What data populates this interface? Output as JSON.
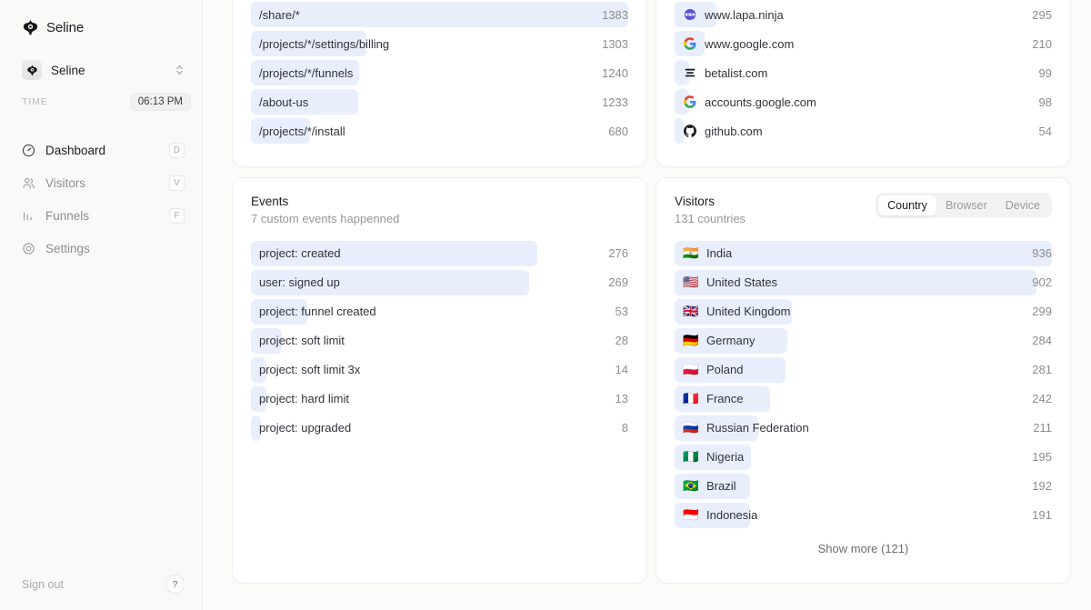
{
  "sidebar": {
    "brand": "Seline",
    "brand_icon": "seline-logo-icon",
    "project": {
      "name": "Seline",
      "icon": "seline-project-icon",
      "chevron": "chevron-up-down-icon"
    },
    "time": {
      "label": "TIME",
      "value": "06:13 PM"
    },
    "nav": [
      {
        "label": "Dashboard",
        "key": "D",
        "icon": "gauge-icon",
        "active": true
      },
      {
        "label": "Visitors",
        "key": "V",
        "icon": "users-icon",
        "active": false
      },
      {
        "label": "Funnels",
        "key": "F",
        "icon": "bar-chart-icon",
        "active": false
      },
      {
        "label": "Settings",
        "key": "",
        "icon": "target-icon",
        "active": false
      }
    ],
    "sign_out": "Sign out",
    "help": "?"
  },
  "colors": {
    "bar_fill": "#e8eefb",
    "page_bg": "#fbfbfa",
    "sidebar_bg": "#f9f9f8",
    "card_bg": "#ffffff"
  },
  "pages_card": {
    "rows": [
      {
        "label": "/share/*",
        "value": "1383",
        "pct": 100.0
      },
      {
        "label": "/projects/*/settings/billing",
        "value": "1303",
        "pct": 30.5
      },
      {
        "label": "/projects/*/funnels",
        "value": "1240",
        "pct": 28.7
      },
      {
        "label": "/about-us",
        "value": "1233",
        "pct": 28.5
      },
      {
        "label": "/projects/*/install",
        "value": "680",
        "pct": 15.6
      }
    ]
  },
  "referrers_card": {
    "rows": [
      {
        "label": "www.lapa.ninja",
        "value": "295",
        "pct": 11.2,
        "icon": "lapa-ninja-favicon"
      },
      {
        "label": "www.google.com",
        "value": "210",
        "pct": 8.0,
        "icon": "google-favicon"
      },
      {
        "label": "betalist.com",
        "value": "99",
        "pct": 3.8,
        "icon": "betalist-favicon"
      },
      {
        "label": "accounts.google.com",
        "value": "98",
        "pct": 3.8,
        "icon": "google-favicon"
      },
      {
        "label": "github.com",
        "value": "54",
        "pct": 2.1,
        "icon": "github-favicon"
      }
    ]
  },
  "events_card": {
    "title": "Events",
    "subtitle": "7 custom events happenned",
    "rows": [
      {
        "label": "project: created",
        "value": "276",
        "pct": 76.0
      },
      {
        "label": "user: signed up",
        "value": "269",
        "pct": 73.8
      },
      {
        "label": "project: funnel created",
        "value": "53",
        "pct": 15.0
      },
      {
        "label": "project: soft limit",
        "value": "28",
        "pct": 8.1
      },
      {
        "label": "project: soft limit 3x",
        "value": "14",
        "pct": 4.2
      },
      {
        "label": "project: hard limit",
        "value": "13",
        "pct": 4.0
      },
      {
        "label": "project: upgraded",
        "value": "8",
        "pct": 2.6
      }
    ]
  },
  "visitors_card": {
    "title": "Visitors",
    "subtitle": "131 countries",
    "tabs": [
      {
        "label": "Country",
        "active": true
      },
      {
        "label": "Browser",
        "active": false
      },
      {
        "label": "Device",
        "active": false
      }
    ],
    "rows": [
      {
        "label": "India",
        "value": "936",
        "pct": 100.0,
        "flag": "🇮🇳"
      },
      {
        "label": "United States",
        "value": "902",
        "pct": 95.8,
        "flag": "🇺🇸"
      },
      {
        "label": "United Kingdom",
        "value": "299",
        "pct": 31.2,
        "flag": "🇬🇧"
      },
      {
        "label": "Germany",
        "value": "284",
        "pct": 29.8,
        "flag": "🇩🇪"
      },
      {
        "label": "Poland",
        "value": "281",
        "pct": 29.4,
        "flag": "🇵🇱"
      },
      {
        "label": "France",
        "value": "242",
        "pct": 25.2,
        "flag": "🇫🇷"
      },
      {
        "label": "Russian Federation",
        "value": "211",
        "pct": 22.1,
        "flag": "🇷🇺"
      },
      {
        "label": "Nigeria",
        "value": "195",
        "pct": 20.3,
        "flag": "🇳🇬"
      },
      {
        "label": "Brazil",
        "value": "192",
        "pct": 20.0,
        "flag": "🇧🇷"
      },
      {
        "label": "Indonesia",
        "value": "191",
        "pct": 19.9,
        "flag": "🇮🇩"
      }
    ],
    "show_more": "Show more (121)"
  }
}
